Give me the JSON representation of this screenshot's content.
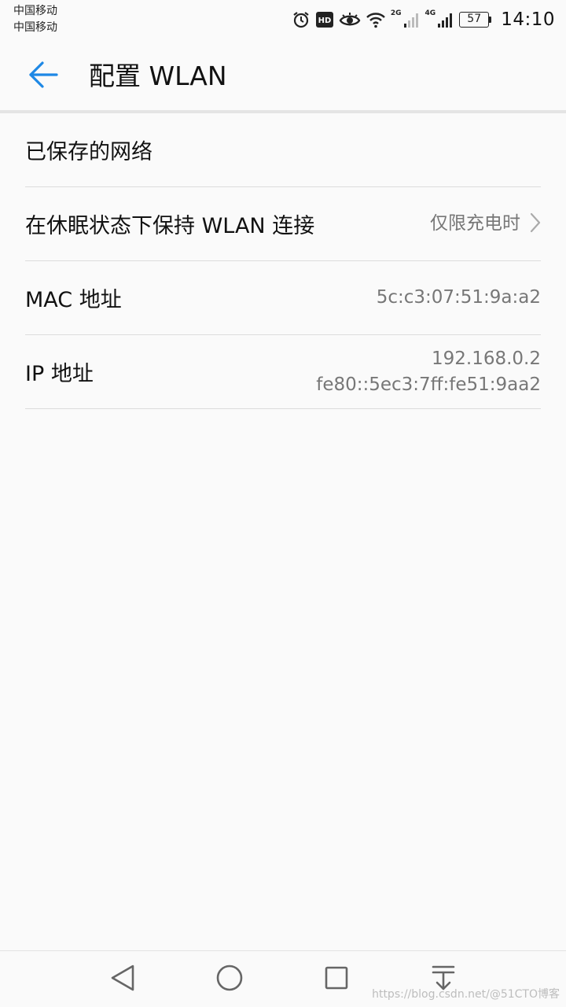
{
  "status_bar": {
    "carrier_1": "中国移动",
    "carrier_2": "中国移动",
    "icons": [
      "alarm-icon",
      "hd-icon",
      "eye-comfort-icon",
      "wifi-icon",
      "signal-2g-icon",
      "signal-4g-icon"
    ],
    "network_tag_1": "2G",
    "network_tag_2": "4G",
    "battery": "57",
    "time": "14:10"
  },
  "app_bar": {
    "back_icon": "arrow-left-icon",
    "title": "配置 WLAN",
    "accent_color": "#1e88e5"
  },
  "list": [
    {
      "label": "已保存的网络"
    },
    {
      "label": "在休眠状态下保持 WLAN 连接",
      "value": "仅限充电时",
      "icon": "chevron-right-icon"
    },
    {
      "label": "MAC 地址",
      "value": "5c:c3:07:51:9a:a2"
    },
    {
      "label": "IP 地址",
      "value_1": "192.168.0.2",
      "value_2": "fe80::5ec3:7ff:fe51:9aa2"
    }
  ],
  "nav_bar": {
    "buttons": [
      "back-triangle-icon",
      "home-circle-icon",
      "recents-square-icon",
      "notification-pulldown-icon"
    ]
  },
  "watermark": "https://blog.csdn.net/@51CTO博客"
}
